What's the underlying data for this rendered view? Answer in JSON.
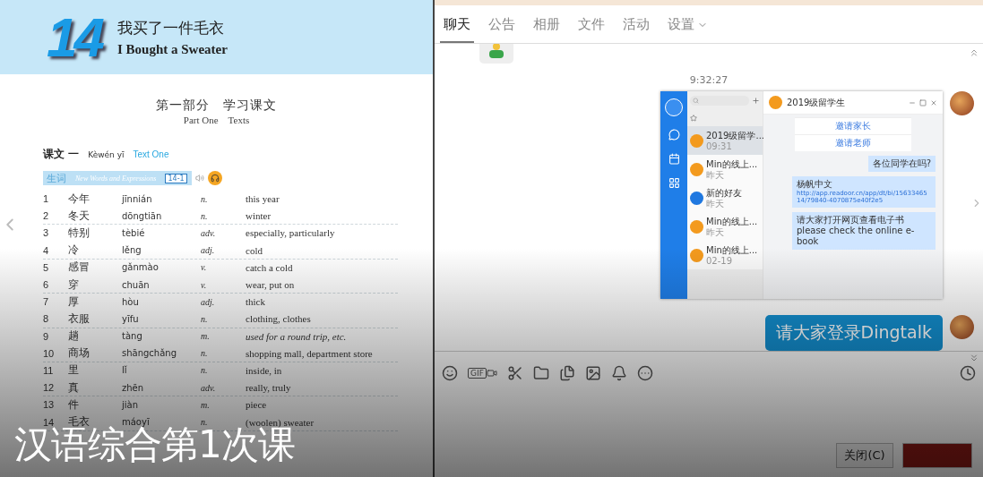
{
  "textbook": {
    "lesson_number": "14",
    "title_zh": "我买了一件毛衣",
    "title_en": "I Bought a Sweater",
    "part_zh": "第一部分　学习课文",
    "part_en": "Part One　Texts",
    "text_heading": {
      "zh": "课文 一",
      "pinyin": "Kèwén yī",
      "en": "Text One"
    },
    "vocab_banner": {
      "zh": "生词",
      "en": "New Words and Expressions",
      "badge": "14-1"
    },
    "vocabulary": [
      {
        "no": "1",
        "hanzi": "今年",
        "pinyin": "jīnnián",
        "pos": "n.",
        "meaning": "this year",
        "italic": false
      },
      {
        "no": "2",
        "hanzi": "冬天",
        "pinyin": "dōngtiān",
        "pos": "n.",
        "meaning": "winter",
        "italic": false
      },
      {
        "no": "3",
        "hanzi": "特别",
        "pinyin": "tèbié",
        "pos": "adv.",
        "meaning": "especially, particularly",
        "italic": false
      },
      {
        "no": "4",
        "hanzi": "冷",
        "pinyin": "lěng",
        "pos": "adj.",
        "meaning": "cold",
        "italic": false
      },
      {
        "no": "5",
        "hanzi": "感冒",
        "pinyin": "gǎnmào",
        "pos": "v.",
        "meaning": "catch a cold",
        "italic": false
      },
      {
        "no": "6",
        "hanzi": "穿",
        "pinyin": "chuān",
        "pos": "v.",
        "meaning": "wear, put on",
        "italic": false
      },
      {
        "no": "7",
        "hanzi": "厚",
        "pinyin": "hòu",
        "pos": "adj.",
        "meaning": "thick",
        "italic": false
      },
      {
        "no": "8",
        "hanzi": "衣服",
        "pinyin": "yīfu",
        "pos": "n.",
        "meaning": "clothing, clothes",
        "italic": false
      },
      {
        "no": "9",
        "hanzi": "趟",
        "pinyin": "tàng",
        "pos": "m.",
        "meaning": "used for a round trip, etc.",
        "italic": true
      },
      {
        "no": "10",
        "hanzi": "商场",
        "pinyin": "shāngchǎng",
        "pos": "n.",
        "meaning": "shopping mall, department store",
        "italic": false
      },
      {
        "no": "11",
        "hanzi": "里",
        "pinyin": "lǐ",
        "pos": "n.",
        "meaning": "inside, in",
        "italic": false
      },
      {
        "no": "12",
        "hanzi": "真",
        "pinyin": "zhēn",
        "pos": "adv.",
        "meaning": "really, truly",
        "italic": false
      },
      {
        "no": "13",
        "hanzi": "件",
        "pinyin": "jiàn",
        "pos": "m.",
        "meaning": "piece",
        "italic": false
      },
      {
        "no": "14",
        "hanzi": "毛衣",
        "pinyin": "máoyī",
        "pos": "n.",
        "meaning": "(woolen) sweater",
        "italic": false
      }
    ]
  },
  "caption": "汉语综合第1次课",
  "chat": {
    "tabs": [
      {
        "label": "聊天",
        "selected": true,
        "dropdown": false
      },
      {
        "label": "公告",
        "selected": false,
        "dropdown": false
      },
      {
        "label": "相册",
        "selected": false,
        "dropdown": false
      },
      {
        "label": "文件",
        "selected": false,
        "dropdown": false
      },
      {
        "label": "活动",
        "selected": false,
        "dropdown": false
      },
      {
        "label": "设置",
        "selected": false,
        "dropdown": true
      }
    ],
    "time": "9:32:27",
    "screenshot": {
      "title": "2019级留学生",
      "conversations": [
        {
          "name": "2019级留学...",
          "time": "09:31",
          "selected": true,
          "color": "#f39a1e"
        },
        {
          "name": "Min的线上...",
          "time": "昨天",
          "selected": false,
          "color": "#f39a1e"
        },
        {
          "name": "新的好友",
          "time": "昨天",
          "selected": false,
          "color": "#1f78e0"
        },
        {
          "name": "Min的线上...",
          "time": "昨天",
          "selected": false,
          "color": "#f39a1e"
        },
        {
          "name": "Min的线上...",
          "time": "02-19",
          "selected": false,
          "color": "#f39a1e"
        }
      ],
      "card_buttons": [
        "邀请家长",
        "邀请老师"
      ],
      "messages": [
        {
          "kind": "text",
          "text": "各位同学在吗?"
        },
        {
          "kind": "link",
          "text": "杨帆中文",
          "link": "http://app.readoor.cn/app/dt/bi/1563346514/79840-4070875e40f2e5"
        },
        {
          "kind": "text",
          "text": "请大家打开网页查看电子书please check the online e-book"
        }
      ]
    },
    "message": "请大家登录Dingtalk",
    "toolbar": [
      {
        "kind": "emoji"
      },
      {
        "kind": "gif",
        "label": "GIF"
      },
      {
        "kind": "scissors"
      },
      {
        "kind": "folder"
      },
      {
        "kind": "files"
      },
      {
        "kind": "image"
      },
      {
        "kind": "bell"
      },
      {
        "kind": "more"
      }
    ],
    "buttons": [
      {
        "kind": "close",
        "label": "关闭(C)"
      },
      {
        "kind": "send"
      }
    ]
  }
}
